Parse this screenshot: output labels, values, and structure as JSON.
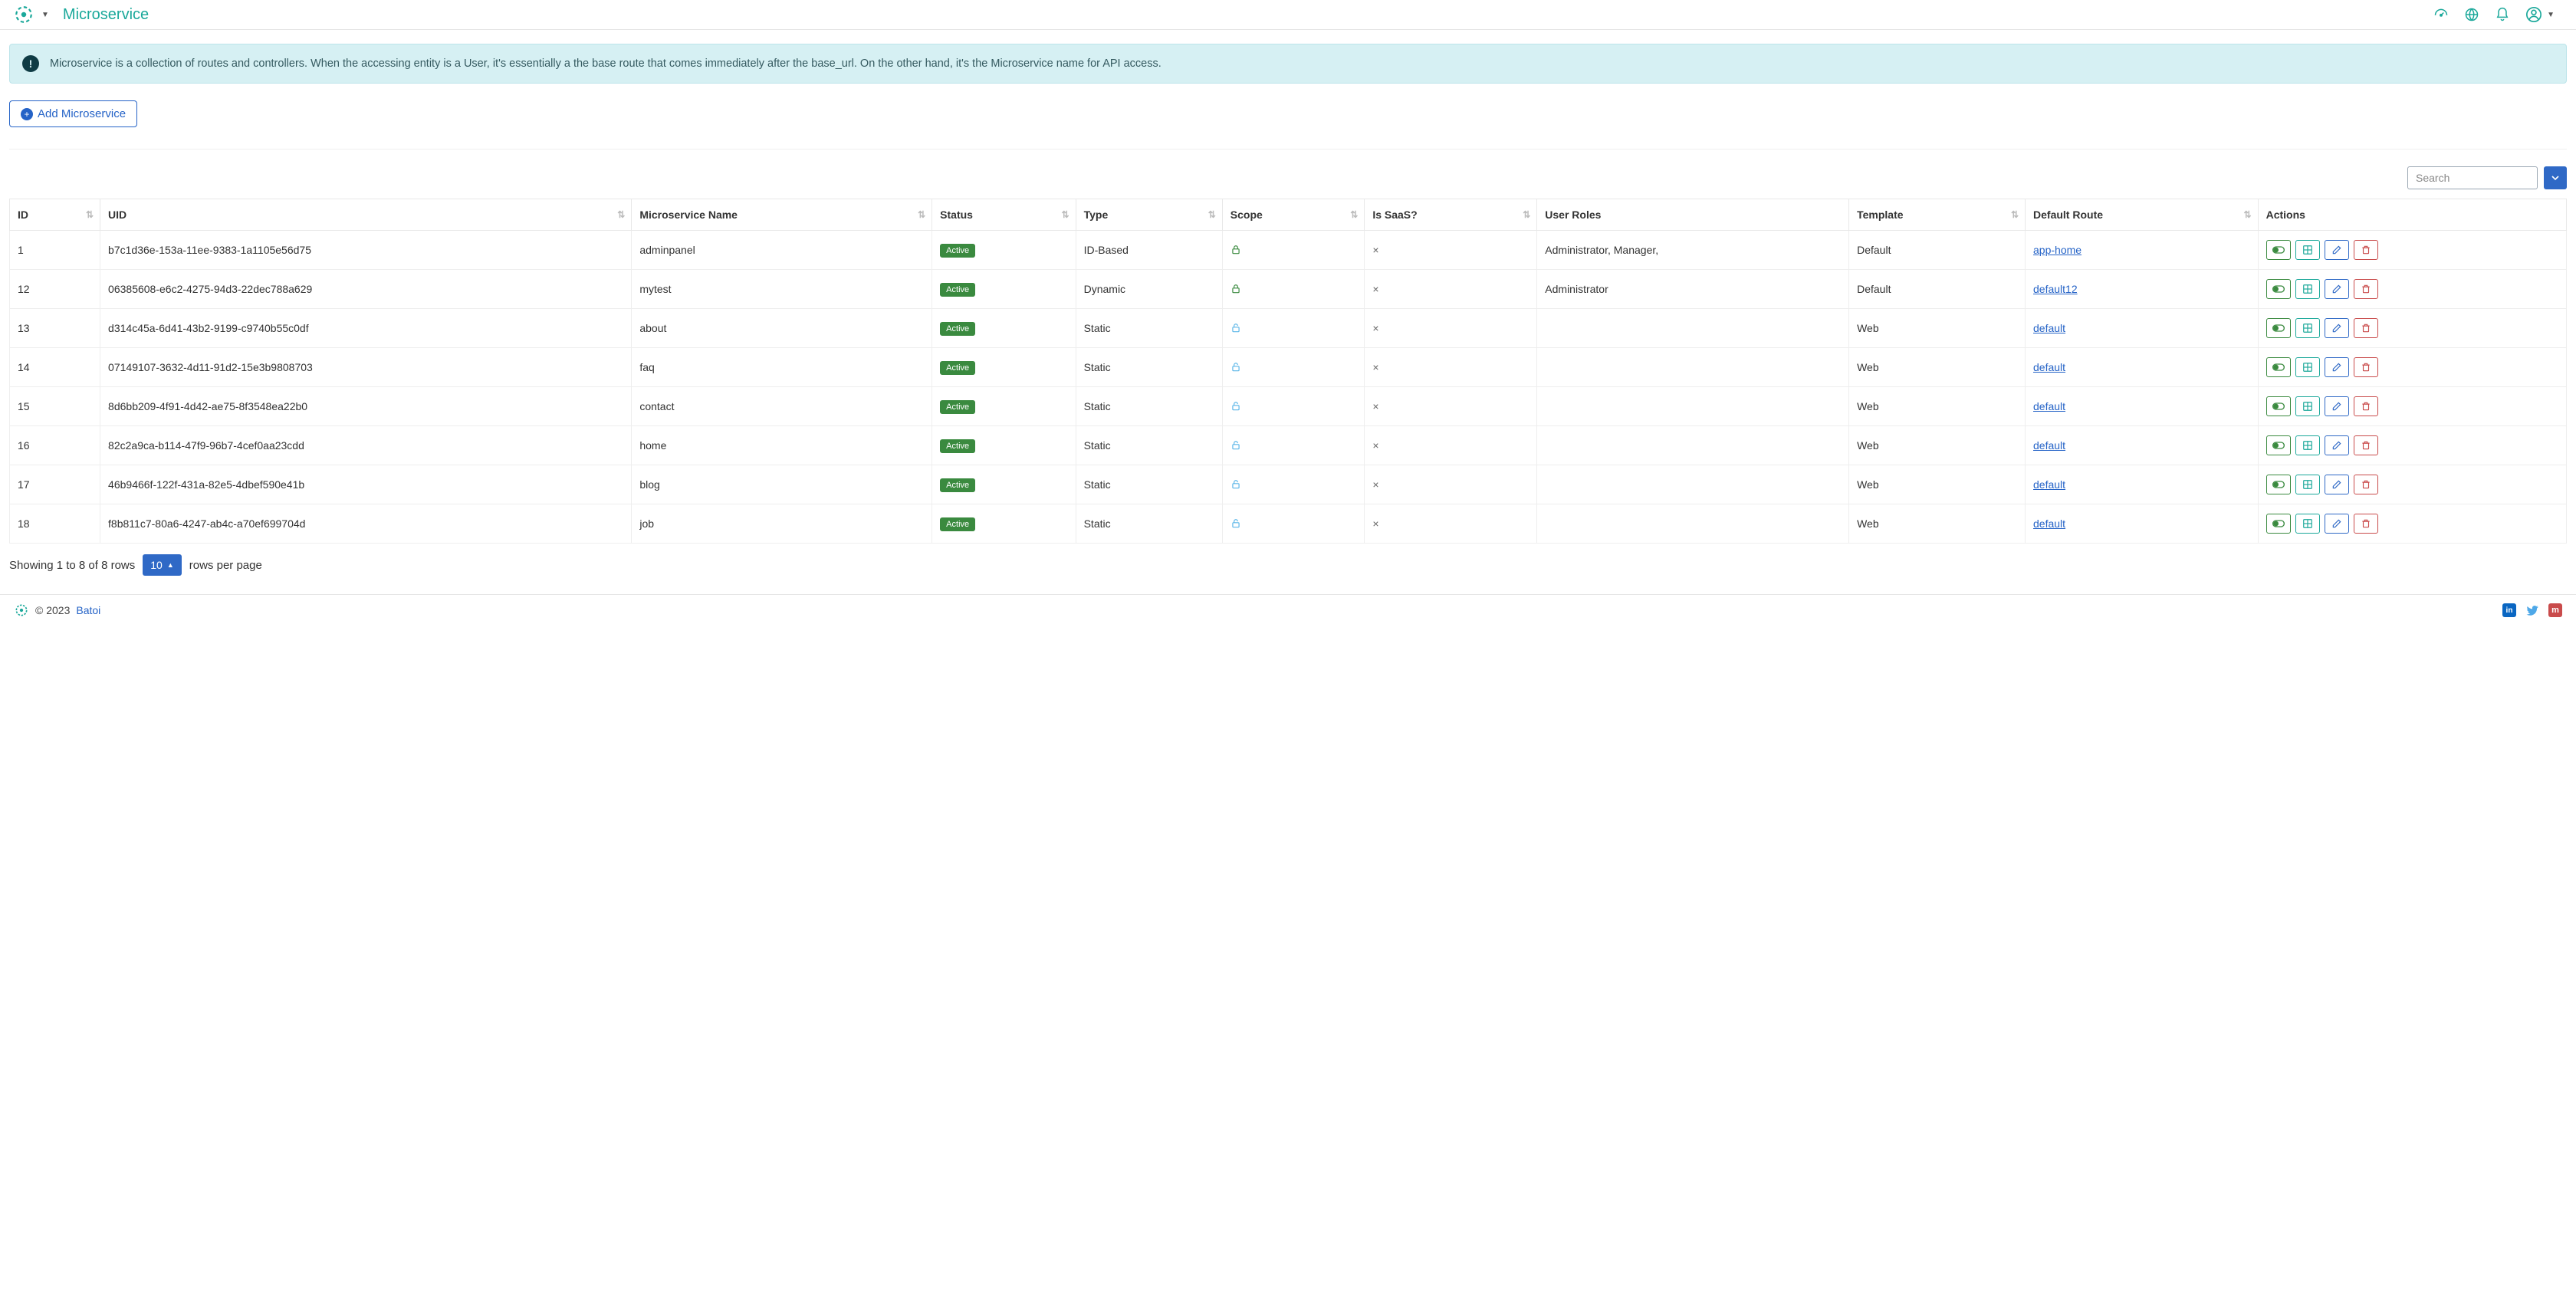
{
  "header": {
    "title": "Microservice"
  },
  "banner": {
    "text": "Microservice is a collection of routes and controllers. When the accessing entity is a User, it's essentially a the base route that comes immediately after the base_url. On the other hand, it's the Microservice name for API access."
  },
  "buttons": {
    "add_label": "Add Microservice"
  },
  "search": {
    "placeholder": "Search"
  },
  "table": {
    "columns": {
      "id": "ID",
      "uid": "UID",
      "name": "Microservice Name",
      "status": "Status",
      "type": "Type",
      "scope": "Scope",
      "is_saas": "Is SaaS?",
      "user_roles": "User Roles",
      "template": "Template",
      "default_route": "Default Route",
      "actions": "Actions"
    },
    "status_label": "Active",
    "rows": [
      {
        "id": "1",
        "uid": "b7c1d36e-153a-11ee-9383-1a1105e56d75",
        "name": "adminpanel",
        "type": "ID-Based",
        "scope_locked": true,
        "is_saas": "×",
        "user_roles": "Administrator, Manager,",
        "template": "Default",
        "route": "app-home"
      },
      {
        "id": "12",
        "uid": "06385608-e6c2-4275-94d3-22dec788a629",
        "name": "mytest",
        "type": "Dynamic",
        "scope_locked": true,
        "is_saas": "×",
        "user_roles": "Administrator",
        "template": "Default",
        "route": "default12"
      },
      {
        "id": "13",
        "uid": "d314c45a-6d41-43b2-9199-c9740b55c0df",
        "name": "about",
        "type": "Static",
        "scope_locked": false,
        "is_saas": "×",
        "user_roles": "",
        "template": "Web",
        "route": "default"
      },
      {
        "id": "14",
        "uid": "07149107-3632-4d11-91d2-15e3b9808703",
        "name": "faq",
        "type": "Static",
        "scope_locked": false,
        "is_saas": "×",
        "user_roles": "",
        "template": "Web",
        "route": "default"
      },
      {
        "id": "15",
        "uid": "8d6bb209-4f91-4d42-ae75-8f3548ea22b0",
        "name": "contact",
        "type": "Static",
        "scope_locked": false,
        "is_saas": "×",
        "user_roles": "",
        "template": "Web",
        "route": "default"
      },
      {
        "id": "16",
        "uid": "82c2a9ca-b114-47f9-96b7-4cef0aa23cdd",
        "name": "home",
        "type": "Static",
        "scope_locked": false,
        "is_saas": "×",
        "user_roles": "",
        "template": "Web",
        "route": "default"
      },
      {
        "id": "17",
        "uid": "46b9466f-122f-431a-82e5-4dbef590e41b",
        "name": "blog",
        "type": "Static",
        "scope_locked": false,
        "is_saas": "×",
        "user_roles": "",
        "template": "Web",
        "route": "default"
      },
      {
        "id": "18",
        "uid": "f8b811c7-80a6-4247-ab4c-a70ef699704d",
        "name": "job",
        "type": "Static",
        "scope_locked": false,
        "is_saas": "×",
        "user_roles": "",
        "template": "Web",
        "route": "default"
      }
    ]
  },
  "pager": {
    "showing_prefix": "Showing 1 to 8 of 8 rows",
    "rows_value": "10",
    "rows_suffix": "rows per page"
  },
  "footer": {
    "copyright": "© 2023",
    "brand": "Batoi"
  }
}
